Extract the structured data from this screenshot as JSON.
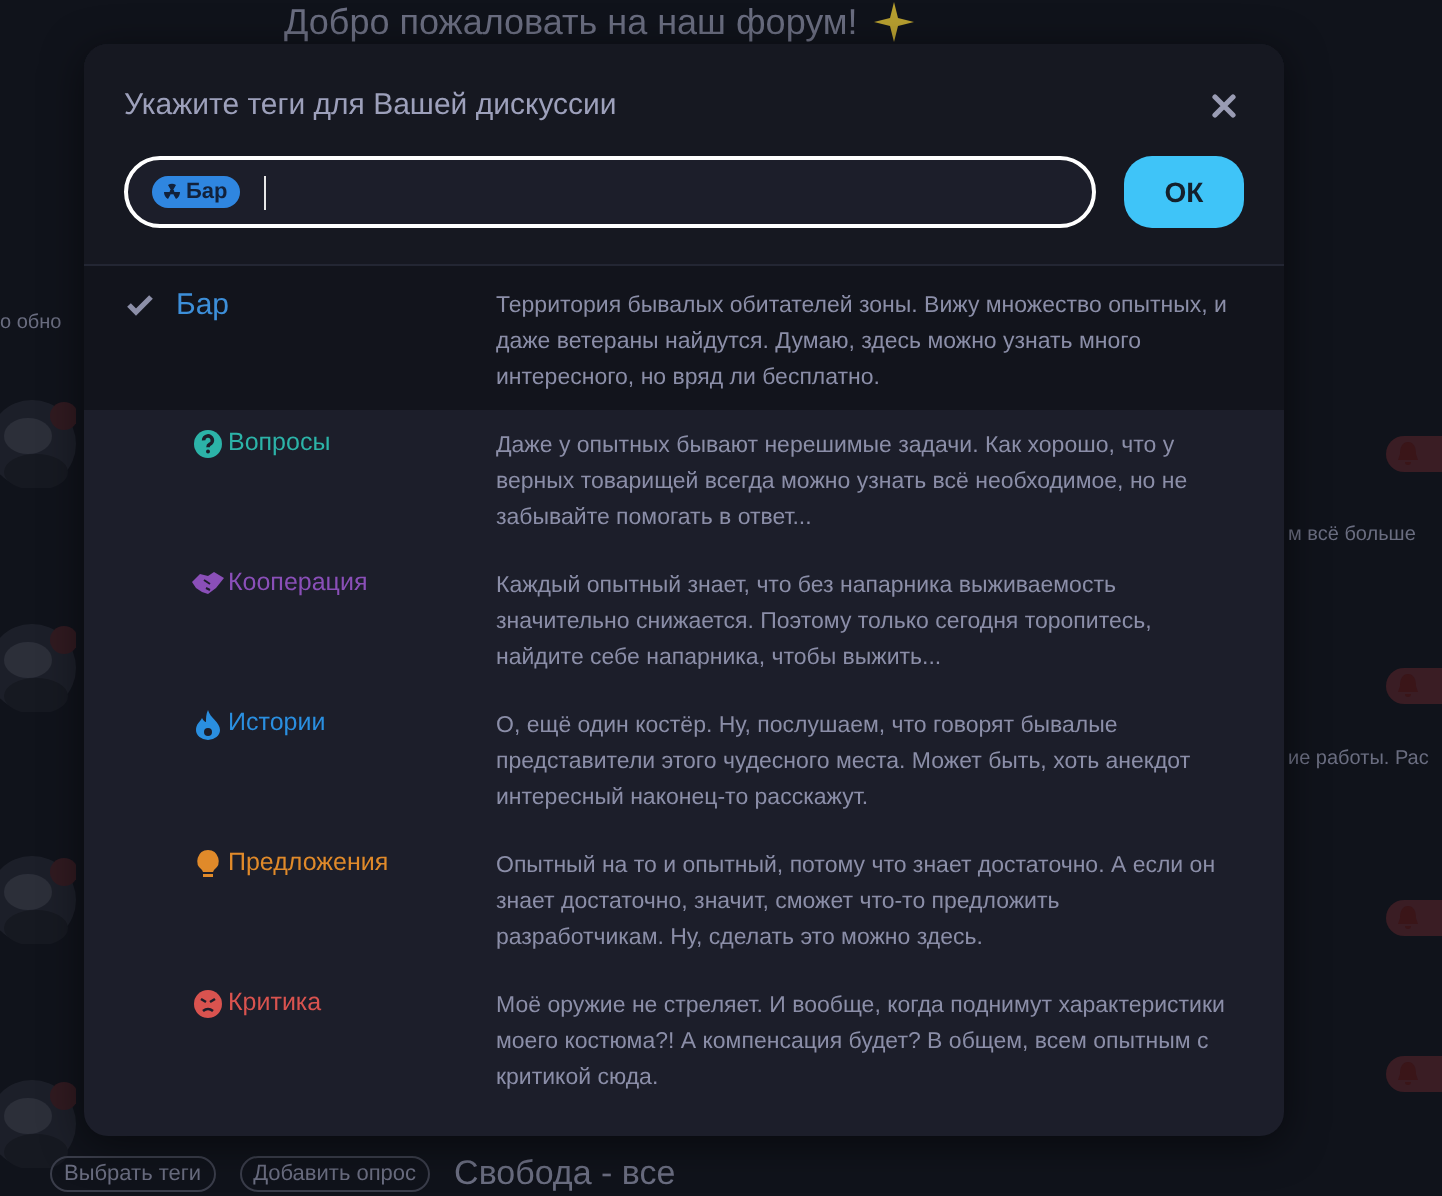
{
  "background": {
    "heading": "Добро пожаловать на наш форум!",
    "snippets": [
      "о обно",
      "м всё больше",
      "ие работы. Рас"
    ],
    "bottom_buttons": [
      "Выбрать теги",
      "Добавить опрос"
    ],
    "bottom_text": "Свобода - все"
  },
  "dialog": {
    "title": "Укажите теги для Вашей дискуссии",
    "chips": [
      "Бар"
    ],
    "ok_button": "ОК"
  },
  "tags": [
    {
      "label": "Бар",
      "selected": true,
      "color": "#3d8fd9",
      "description": "Территория бывалых обитателей зоны. Вижу множество опытных, и даже ветераны найдутся. Думаю, здесь можно узнать много интересного, но вряд ли бесплатно.",
      "children": [
        {
          "label": "Вопросы",
          "kind": "question",
          "selected": false,
          "color": "#2cb3a8",
          "description": "Даже у опытных бывают нерешимые задачи. Как хорошо, что у верных товарищей всегда можно узнать всё необходимое, но не забывайте помогать в ответ..."
        },
        {
          "label": "Кооперация",
          "kind": "handshake",
          "selected": false,
          "color": "#8a4fb8",
          "description": "Каждый опытный знает, что без напарника выживаемость значительно снижается. Поэтому только сегодня торопитесь, найдите себе напарника, чтобы выжить..."
        },
        {
          "label": "Истории",
          "kind": "fire",
          "selected": false,
          "color": "#2a8fe0",
          "description": "О, ещё один костёр. Ну, послушаем, что говорят бывалые представители этого чудесного места. Может быть, хоть анекдот интересный наконец-то расскажут."
        },
        {
          "label": "Предложения",
          "kind": "bulb",
          "selected": false,
          "color": "#e08a2a",
          "description": "Опытный на то и опытный, потому что знает достаточно. А если он знает достаточно, значит, сможет что-то предложить разработчикам. Ну, сделать это можно здесь."
        },
        {
          "label": "Критика",
          "kind": "angry",
          "selected": false,
          "color": "#d9534f",
          "description": "Моё оружие не стреляет. И вообще, когда поднимут характеристики моего костюма?! А компенсация будет? В общем, всем опытным с критикой сюда."
        }
      ]
    }
  ]
}
